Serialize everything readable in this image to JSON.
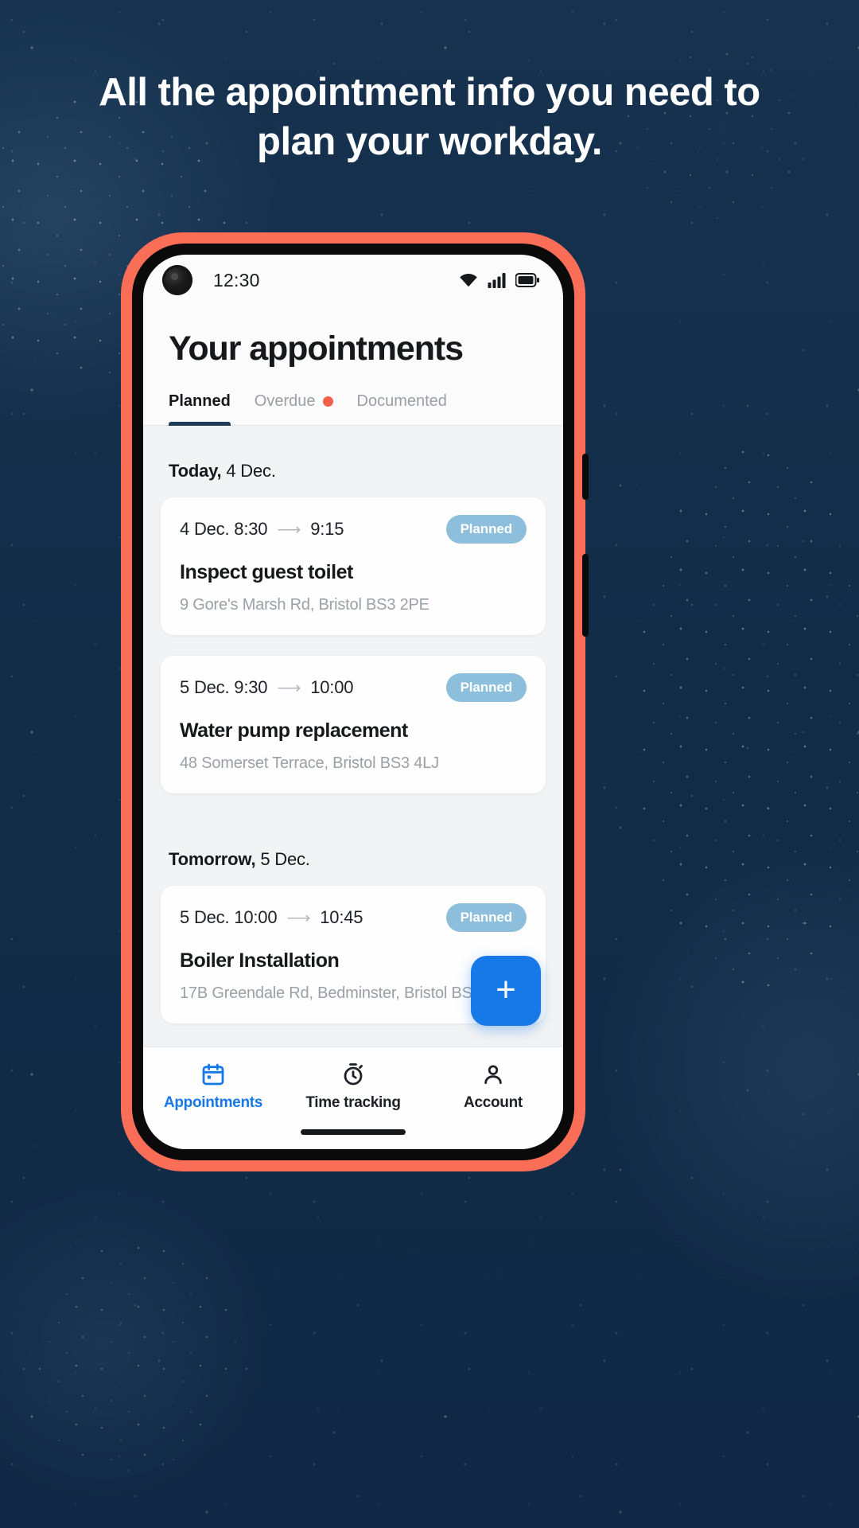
{
  "promo": {
    "headline": "All the appointment info you need to plan your workday.",
    "background_color": "#14304f",
    "frame_color": "#fa6d57"
  },
  "statusbar": {
    "time": "12:30",
    "icons": [
      "wifi-icon",
      "cellular-signal-icon",
      "battery-icon"
    ]
  },
  "screen": {
    "title": "Your appointments",
    "tabs": [
      {
        "label": "Planned",
        "active": true,
        "dot": false
      },
      {
        "label": "Overdue",
        "active": false,
        "dot": true
      },
      {
        "label": "Documented",
        "active": false,
        "dot": false
      }
    ],
    "sections": [
      {
        "day_label": "Today,",
        "day_date": " 4 Dec.",
        "appointments": [
          {
            "start": "4 Dec. 8:30",
            "end": "9:15",
            "status": "Planned",
            "title": "Inspect guest toilet",
            "address": "9 Gore's Marsh Rd, Bristol BS3 2PE"
          },
          {
            "start": "5 Dec. 9:30",
            "end": "10:00",
            "status": "Planned",
            "title": "Water pump replacement",
            "address": "48 Somerset Terrace, Bristol BS3 4LJ"
          }
        ]
      },
      {
        "day_label": "Tomorrow,",
        "day_date": " 5 Dec.",
        "appointments": [
          {
            "start": "5 Dec. 10:00",
            "end": "10:45",
            "status": "Planned",
            "title": "Boiler Installation",
            "address": "17B Greendale Rd, Bedminster, Bristol BS3"
          }
        ]
      }
    ],
    "fab": {
      "icon": "plus-icon",
      "label": "+",
      "color": "#1778e8"
    },
    "bottom_nav": [
      {
        "label": "Appointments",
        "icon": "calendar-icon",
        "active": true
      },
      {
        "label": "Time tracking",
        "icon": "stopwatch-icon",
        "active": false
      },
      {
        "label": "Account",
        "icon": "person-icon",
        "active": false
      }
    ]
  }
}
